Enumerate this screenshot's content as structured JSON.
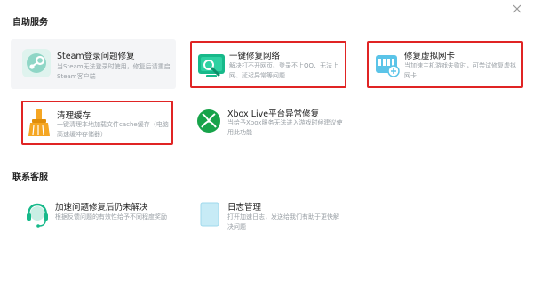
{
  "sections": {
    "self_service": "自助服务",
    "contact": "联系客服"
  },
  "cards": {
    "steam": {
      "title": "Steam登录问题修复",
      "desc": "当Steam无法登录时使用，修复后请重启Steam客户端"
    },
    "network": {
      "title": "一键修复网络",
      "desc": "解决打不开网页、登录不上QQ、无法上网、延迟异常等问题"
    },
    "vnic": {
      "title": "修复虚拟网卡",
      "desc": "当加速主机游戏失败时，可尝试修复虚拟网卡"
    },
    "cache": {
      "title": "清理缓存",
      "desc": "一键清理本地加载文件cache缓存（电脑高速缓冲存储器）"
    },
    "xbox": {
      "title": "Xbox Live平台异常修复",
      "desc": "当给予Xbox服务无法进入游戏时候建议使用此功能"
    },
    "support": {
      "title": "加速问题修复后仍未解决",
      "desc": "根据反馈问题的有效性给予不同程度奖励"
    },
    "logs": {
      "title": "日志管理",
      "desc": "打开加速日志，发送给我们有助于更快解决问题"
    }
  },
  "icons": {
    "close": "close-icon",
    "steam": "steam-icon",
    "network": "network-repair-icon",
    "vnic": "virtual-nic-icon",
    "cache": "broom-icon",
    "xbox": "xbox-icon",
    "support": "headset-icon",
    "logs": "log-file-icon"
  },
  "colors": {
    "accent": "#00b894",
    "highlight": "#e02424",
    "cache_orange": "#f5a623",
    "xbox_green": "#17a34a",
    "nic_blue": "#5bc4e8"
  }
}
